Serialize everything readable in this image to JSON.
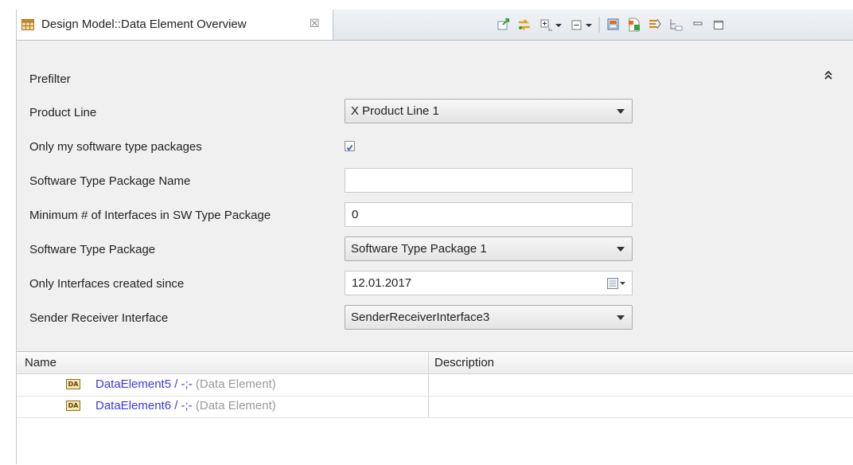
{
  "tab": {
    "title": "Design Model::Data Element Overview",
    "close": "☒"
  },
  "toolbar": {
    "icons": [
      "export-icon",
      "sync-icon",
      "expand-all-icon",
      "collapse-all-icon",
      "open-editor-icon",
      "new-document-icon",
      "filter-icon",
      "hierarchy-icon",
      "minimize-icon",
      "maximize-icon"
    ]
  },
  "prefilter": {
    "title": "Prefilter",
    "collapse_glyph": "⌃"
  },
  "fields": {
    "product_line": {
      "label": "Product Line",
      "value": "X Product Line 1"
    },
    "only_my_packages": {
      "label": "Only my software type packages",
      "checked": true,
      "check_glyph": "✓"
    },
    "package_name": {
      "label": "Software Type Package Name",
      "value": ""
    },
    "min_interfaces": {
      "label": "Minimum # of Interfaces in SW Type Package",
      "value": "0"
    },
    "software_type_package": {
      "label": "Software Type Package",
      "value": "Software Type Package 1"
    },
    "interfaces_since": {
      "label": "Only Interfaces created since",
      "value": "12.01.2017"
    },
    "sender_receiver": {
      "label": "Sender Receiver Interface",
      "value": "SenderReceiverInterface3"
    }
  },
  "table": {
    "columns": [
      "Name",
      "Description"
    ],
    "rows": [
      {
        "icon_text": "DA",
        "name": "DataElement5 / -;-",
        "type": "(Data Element)",
        "description": ""
      },
      {
        "icon_text": "DA",
        "name": "DataElement6 / -;-",
        "type": "(Data Element)",
        "description": ""
      }
    ]
  },
  "colors": {
    "link": "#3a3adf",
    "muted": "#9a9a9a",
    "form_bg": "#f0f0f0"
  }
}
